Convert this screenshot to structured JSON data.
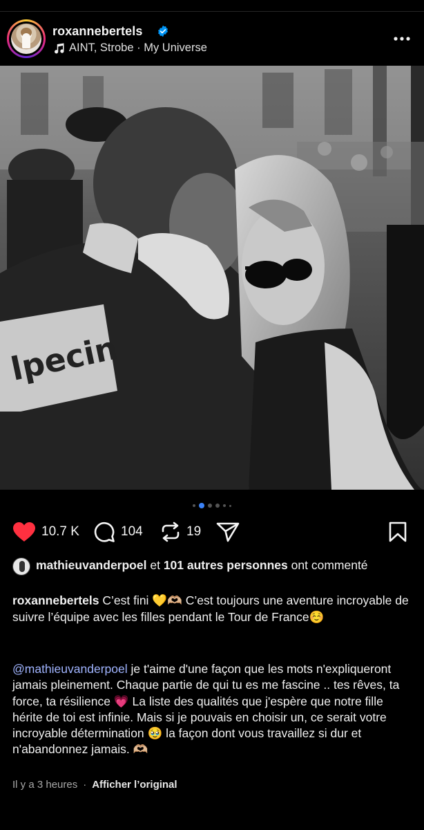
{
  "post": {
    "username": "roxannebertels",
    "music": "AINT, Strobe · My Universe",
    "icons": {
      "verified": "verified-badge-icon",
      "music": "music-note-icon",
      "more": "more-options-icon"
    }
  },
  "media": {
    "carousel_count": 6,
    "carousel_active_index": 1
  },
  "actions": {
    "likes": "10.7 K",
    "comments": "104",
    "reposts": "19"
  },
  "liked_by": {
    "user": "mathieuvanderpoel",
    "connector": "et",
    "others": "101 autres personnes",
    "suffix": "ont commenté"
  },
  "caption": {
    "author": "roxannebertels",
    "text": "C’est fini 💛🫶🏼 C’est toujours une aventure incroyable de suivre l’équipe avec les filles pendant le Tour de France☺️",
    "mention": "@mathieuvanderpoel",
    "text2": "je t'aime d'une façon que les mots n'expliqueront jamais pleinement. Chaque partie de qui tu es me fascine .. tes rêves, ta force, ta résilience 💗 La liste des qualités que j'espère que notre fille hérite de toi est infinie. Mais si je pouvais en choisir un, ce serait votre incroyable détermination 🥹 la façon dont vous travaillez si dur et n'abandonnez jamais. 🫶🏼"
  },
  "meta": {
    "time": "Il y a 3 heures",
    "separator": "·",
    "translate": "Afficher l’original"
  },
  "colors": {
    "background": "#000000",
    "like_red": "#ff3040",
    "active_dot": "#3b82f6",
    "verified_blue": "#0095f6",
    "mention": "#a0b4ff"
  }
}
